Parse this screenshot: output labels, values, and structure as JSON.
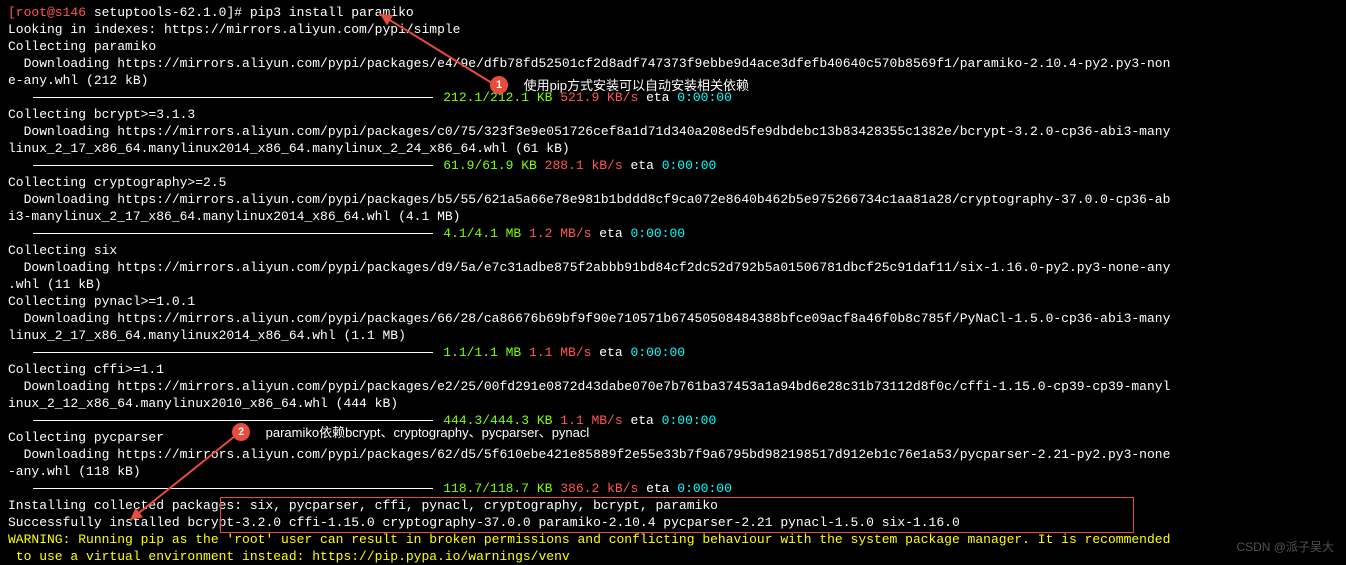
{
  "prompt": {
    "user_host": "[root@s146",
    "path": " setuptools-62.1.0]#",
    "command": " pip3 install paramiko"
  },
  "lines": {
    "indexes": "Looking in indexes: https://mirrors.aliyun.com/pypi/simple",
    "collect_paramiko": "Collecting paramiko",
    "dl_paramiko": "  Downloading https://mirrors.aliyun.com/pypi/packages/e4/9e/dfb78fd52501cf2d8adf747373f9ebbe9d4ace3dfefb40640c570b8569f1/paramiko-2.10.4-py2.py3-non",
    "dl_paramiko2": "e-any.whl (212 kB)",
    "collect_bcrypt": "Collecting bcrypt>=3.1.3",
    "dl_bcrypt": "  Downloading https://mirrors.aliyun.com/pypi/packages/c0/75/323f3e9e051726cef8a1d71d340a208ed5fe9dbdebc13b83428355c1382e/bcrypt-3.2.0-cp36-abi3-many",
    "dl_bcrypt2": "linux_2_17_x86_64.manylinux2014_x86_64.manylinux_2_24_x86_64.whl (61 kB)",
    "collect_crypto": "Collecting cryptography>=2.5",
    "dl_crypto": "  Downloading https://mirrors.aliyun.com/pypi/packages/b5/55/621a5a66e78e981b1bddd8cf9ca072e8640b462b5e975266734c1aa81a28/cryptography-37.0.0-cp36-ab",
    "dl_crypto2": "i3-manylinux_2_17_x86_64.manylinux2014_x86_64.whl (4.1 MB)",
    "collect_six": "Collecting six",
    "dl_six": "  Downloading https://mirrors.aliyun.com/pypi/packages/d9/5a/e7c31adbe875f2abbb91bd84cf2dc52d792b5a01506781dbcf25c91daf11/six-1.16.0-py2.py3-none-any",
    "dl_six2": ".whl (11 kB)",
    "collect_pynacl": "Collecting pynacl>=1.0.1",
    "dl_pynacl": "  Downloading https://mirrors.aliyun.com/pypi/packages/66/28/ca86676b69bf9f90e710571b67450508484388bfce09acf8a46f0b8c785f/PyNaCl-1.5.0-cp36-abi3-many",
    "dl_pynacl2": "linux_2_17_x86_64.manylinux2014_x86_64.whl (1.1 MB)",
    "collect_cffi": "Collecting cffi>=1.1",
    "dl_cffi": "  Downloading https://mirrors.aliyun.com/pypi/packages/e2/25/00fd291e0872d43dabe070e7b761ba37453a1a94bd6e28c31b73112d8f0c/cffi-1.15.0-cp39-cp39-manyl",
    "dl_cffi2": "inux_2_12_x86_64.manylinux2010_x86_64.whl (444 kB)",
    "collect_pycparser": "Collecting pycparser",
    "dl_pycparser": "  Downloading https://mirrors.aliyun.com/pypi/packages/62/d5/5f610ebe421e85889f2e55e33b7f9a6795bd982198517d912eb1c76e1a53/pycparser-2.21-py2.py3-none",
    "dl_pycparser2": "-any.whl (118 kB)",
    "installing": "Installing collected packages: six, pycparser, cffi, pynacl, cryptography, bcrypt, paramiko",
    "success": "Successfully installed bcrypt-3.2.0 cffi-1.15.0 cryptography-37.0.0 paramiko-2.10.4 pycparser-2.21 pynacl-1.5.0 six-1.16.0",
    "warn1": "WARNING: Running pip as the 'root' user can result in broken permissions and conflicting behaviour with the system package manager. It is recommended",
    "warn2": " to use a virtual environment instead: https://pip.pypa.io/warnings/venv"
  },
  "progress": {
    "paramiko": {
      "left": "212.1/212.1 KB",
      "speed": " 521.9 KB/s",
      "eta_lbl": " eta ",
      "eta": "0:00:00"
    },
    "bcrypt": {
      "left": "61.9/61.9 KB",
      "speed": " 288.1 kB/s",
      "eta_lbl": " eta ",
      "eta": "0:00:00"
    },
    "crypto": {
      "left": "4.1/4.1 MB",
      "speed": " 1.2 MB/s",
      "eta_lbl": " eta ",
      "eta": "0:00:00"
    },
    "pynacl": {
      "left": "1.1/1.1 MB",
      "speed": " 1.1 MB/s",
      "eta_lbl": " eta ",
      "eta": "0:00:00"
    },
    "cffi": {
      "left": "444.3/444.3 KB",
      "speed": " 1.1 MB/s",
      "eta_lbl": " eta ",
      "eta": "0:00:00"
    },
    "pycparser": {
      "left": "118.7/118.7 KB",
      "speed": " 386.2 kB/s",
      "eta_lbl": " eta ",
      "eta": "0:00:00"
    }
  },
  "annotations": {
    "a1": {
      "num": "1",
      "text": "使用pip方式安装可以自动安装相关依赖"
    },
    "a2": {
      "num": "2",
      "text": "paramiko依赖bcrypt、cryptography、pycparser、pynacl"
    }
  },
  "watermark": "CSDN @派子吴大"
}
